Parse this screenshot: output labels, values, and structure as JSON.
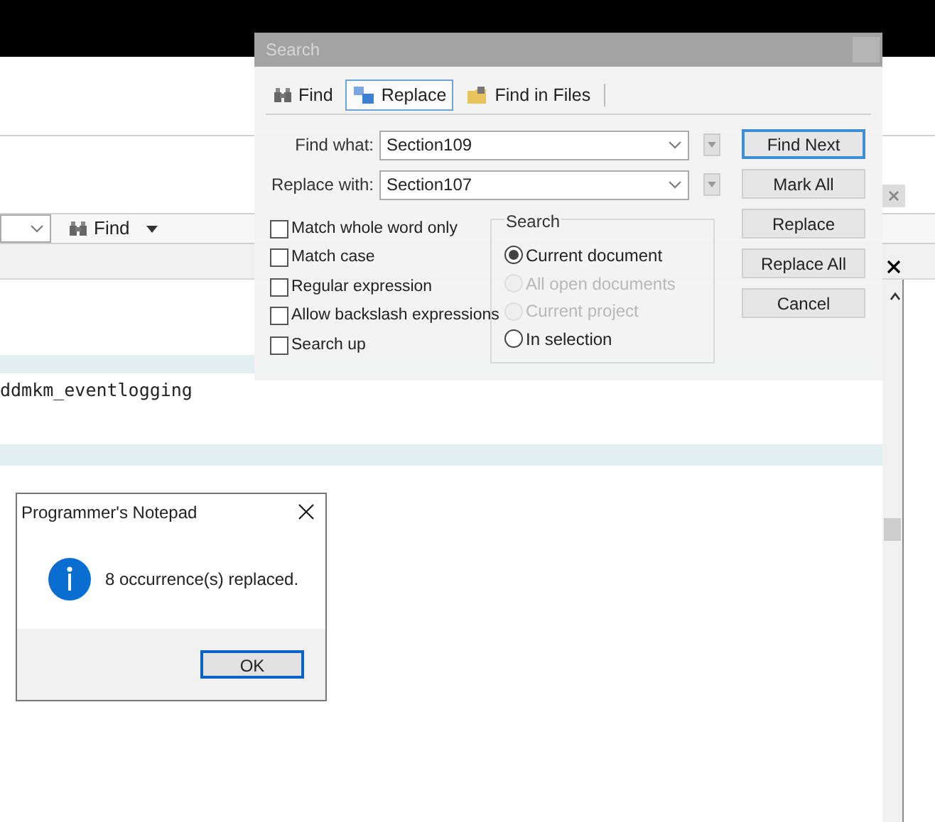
{
  "editor": {
    "toolbar": {
      "find_button": "Find"
    },
    "code_line": "ddmkm_eventlogging"
  },
  "search_dialog": {
    "title": "Search",
    "tabs": [
      {
        "label": "Find",
        "selected": false,
        "kind": "find"
      },
      {
        "label": "Replace",
        "selected": true,
        "kind": "replace"
      },
      {
        "label": "Find in Files",
        "selected": false,
        "kind": "files"
      }
    ],
    "find_what": {
      "label": "Find what:",
      "value": "Section109"
    },
    "replace_with": {
      "label": "Replace with:",
      "value": "Section107"
    },
    "options": [
      {
        "label": "Match whole word only",
        "checked": false
      },
      {
        "label": "Match case",
        "checked": false
      },
      {
        "label": "Regular expression",
        "checked": false
      },
      {
        "label": "Allow backslash expressions",
        "checked": false
      },
      {
        "label": "Search up",
        "checked": false
      }
    ],
    "scope": {
      "title": "Search",
      "options": [
        {
          "label": "Current document",
          "selected": true,
          "disabled": false
        },
        {
          "label": "All open documents",
          "selected": false,
          "disabled": true
        },
        {
          "label": "Current project",
          "selected": false,
          "disabled": true
        },
        {
          "label": "In selection",
          "selected": false,
          "disabled": false
        }
      ]
    },
    "buttons": [
      {
        "label": "Find Next",
        "focused": true
      },
      {
        "label": "Mark All",
        "focused": false
      },
      {
        "label": "Replace",
        "focused": false
      },
      {
        "label": "Replace All",
        "focused": false
      },
      {
        "label": "Cancel",
        "focused": false
      }
    ]
  },
  "message_box": {
    "title": "Programmer's Notepad",
    "message": "8 occurrence(s) replaced.",
    "button": "OK"
  }
}
